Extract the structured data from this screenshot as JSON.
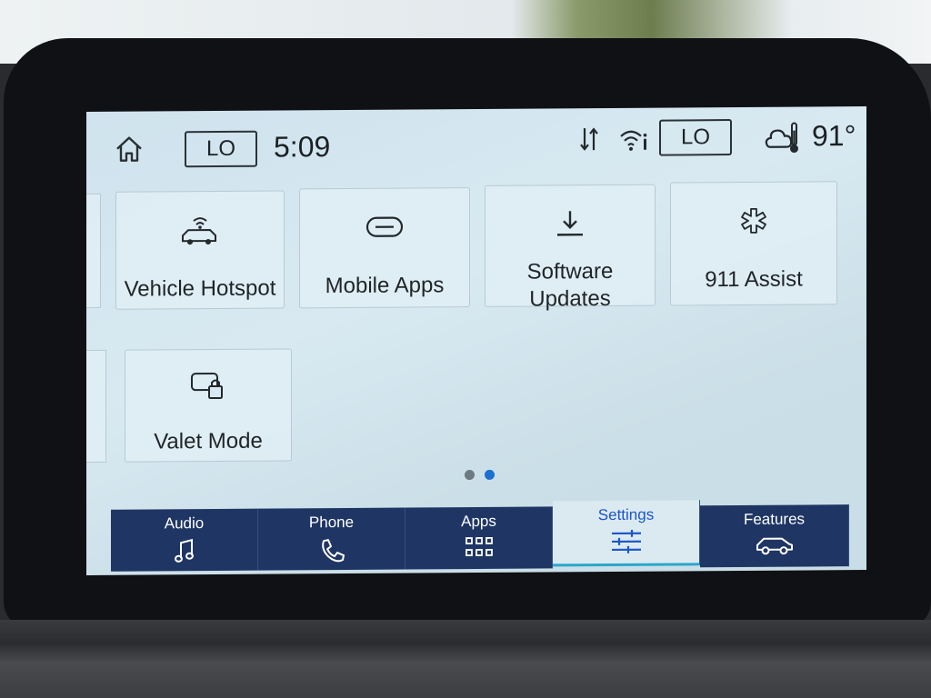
{
  "status_bar": {
    "home_icon": "home-icon",
    "climate_left": "LO",
    "time": "5:09",
    "data_icon": "data-transfer-icon",
    "wifi_icon": "wifi-info-icon",
    "climate_right": "LO",
    "weather_icon": "cloud-thermometer-icon",
    "temperature": "91°"
  },
  "tiles": [
    {
      "label": "Vehicle Hotspot",
      "icon": "car-hotspot-icon"
    },
    {
      "label": "Mobile Apps",
      "icon": "link-icon"
    },
    {
      "label_line1": "Software",
      "label_line2": "Updates",
      "icon": "download-icon"
    },
    {
      "label": "911 Assist",
      "icon": "medical-star-icon"
    },
    {
      "label": "Valet Mode",
      "icon": "screen-lock-icon"
    }
  ],
  "pagination": {
    "pages": 2,
    "current": 2
  },
  "nav": [
    {
      "label": "Audio",
      "icon": "music-note-icon"
    },
    {
      "label": "Phone",
      "icon": "phone-icon"
    },
    {
      "label": "Apps",
      "icon": "apps-grid-icon"
    },
    {
      "label": "Settings",
      "icon": "sliders-icon",
      "active": true
    },
    {
      "label": "Features",
      "icon": "car-icon"
    }
  ],
  "colors": {
    "nav_background": "#1f3664",
    "active_tab_text": "#1d56c8",
    "active_dot": "#1d6fd0",
    "inactive_dot": "#6d7a80"
  }
}
